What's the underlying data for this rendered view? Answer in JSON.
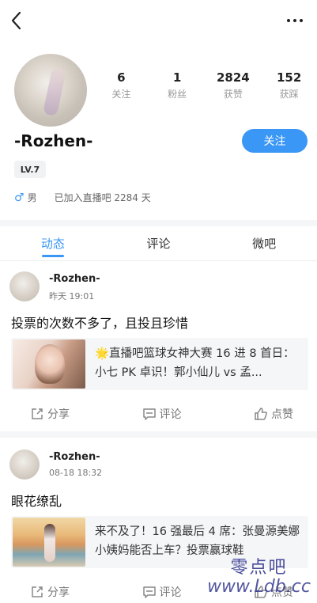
{
  "profile": {
    "username": "-Rozhen-",
    "level": "LV.7",
    "gender": "男",
    "joined": "已加入直播吧 2284 天",
    "follow_label": "关注",
    "stats": [
      {
        "num": "6",
        "label": "关注"
      },
      {
        "num": "1",
        "label": "粉丝"
      },
      {
        "num": "2824",
        "label": "获赞"
      },
      {
        "num": "152",
        "label": "获踩"
      }
    ]
  },
  "tabs": [
    {
      "label": "动态",
      "active": true
    },
    {
      "label": "评论",
      "active": false
    },
    {
      "label": "微吧",
      "active": false
    }
  ],
  "posts": [
    {
      "author": "-Rozhen-",
      "time": "昨天 19:01",
      "text": "投票的次数不多了，且投且珍惜",
      "card_title": "🌟直播吧篮球女神大赛 16 进 8 首日：小七 PK 卓识！郭小仙儿 vs 孟..."
    },
    {
      "author": "-Rozhen-",
      "time": "08-18 18:32",
      "text": "眼花缭乱",
      "card_title": "来不及了！16 强最后 4 席：张曼源美娜小姨妈能否上车？投票赢球鞋"
    }
  ],
  "actions": {
    "share": "分享",
    "comment": "评论",
    "like": "点赞"
  },
  "watermark": {
    "cn": "零点吧",
    "url": "www.Ldb.cc"
  },
  "colors": {
    "accent": "#3a97f5"
  }
}
